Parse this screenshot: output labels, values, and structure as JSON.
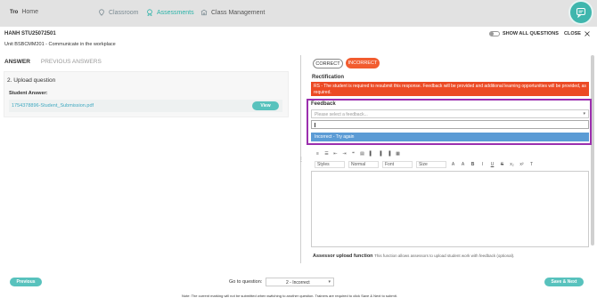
{
  "nav": {
    "brand": "Tro",
    "home": "Home",
    "classroom": "Classroom",
    "assessments": "Assessments",
    "class_management": "Class Management"
  },
  "header": {
    "student": "HANH STU25072501",
    "unit": "Unit BSBCMM201 - Communicate in the workplace",
    "show_all": "SHOW ALL QUESTIONS",
    "close": "CLOSE"
  },
  "tabs": [
    "ANSWER",
    "PREVIOUS ANSWERS"
  ],
  "question": {
    "title": "2. Upload question",
    "answer_label": "Student Answer:",
    "file": "1754378896-Student_Submission.pdf",
    "view": "View"
  },
  "marking": {
    "correct": "CORRECT",
    "incorrect": "INCORRECT",
    "rectification_label": "Rectification",
    "rectification_text": "RS - The student is required to resubmit this response. Feedback will be provided and additional learning opportunities will be provided, as required."
  },
  "feedback": {
    "label": "Feedback",
    "placeholder": "Please select a feedback...",
    "option": "Incorrect - Try again"
  },
  "editor": {
    "styles": "Styles",
    "format": "Normal",
    "font": "Font",
    "size": "Size"
  },
  "assessor": {
    "title": "Assessor upload function",
    "desc": "This function allows assessors to upload student work with feedback (optional)."
  },
  "footer": {
    "previous": "Previous",
    "goto_label": "Go to question:",
    "goto_value": "2 - Incorrect",
    "save": "Save & Next",
    "note": "Note: The current marking will not be submitted when switching to another question. Trainers are required to click Save & Next to submit."
  },
  "colors": {
    "accent": "#58c2bd",
    "incorrect": "#f25c2f",
    "alert": "#ec4a24",
    "highlight_border": "#9b2fae",
    "option_bg": "#5b9bd5"
  }
}
